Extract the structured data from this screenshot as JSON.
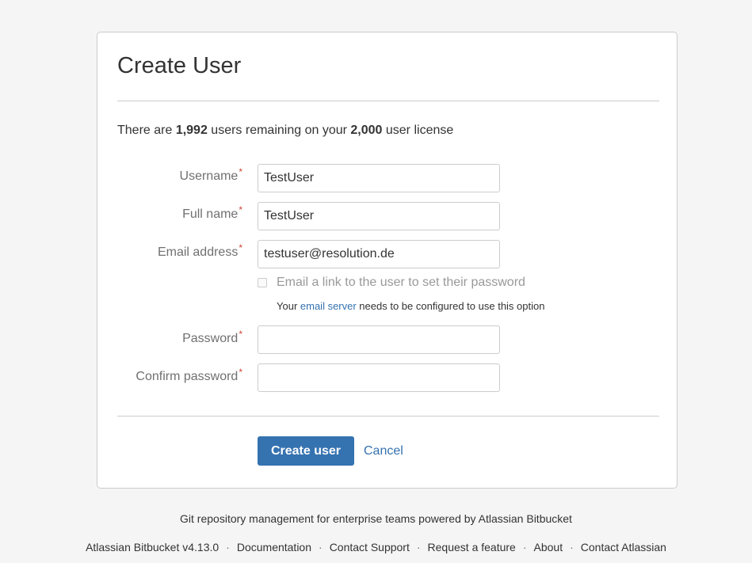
{
  "page": {
    "title": "Create User"
  },
  "license": {
    "prefix": "There are ",
    "remaining": "1,992",
    "middle": " users remaining on your ",
    "total": "2,000",
    "suffix": " user license"
  },
  "form": {
    "username": {
      "label": "Username",
      "value": "TestUser"
    },
    "full_name": {
      "label": "Full name",
      "value": "TestUser"
    },
    "email": {
      "label": "Email address",
      "value": "testuser@resolution.de"
    },
    "email_link_checkbox": {
      "label": "Email a link to the user to set their password",
      "checked": false
    },
    "email_hint": {
      "prefix": "Your ",
      "link": "email server",
      "suffix": " needs to be configured to use this option"
    },
    "password": {
      "label": "Password",
      "value": ""
    },
    "confirm_password": {
      "label": "Confirm password",
      "value": ""
    },
    "required_marker": "*"
  },
  "actions": {
    "create": "Create user",
    "cancel": "Cancel"
  },
  "footer": {
    "tagline": "Git repository management for enterprise teams powered by Atlassian Bitbucket",
    "separator": "·",
    "links": [
      "Atlassian Bitbucket v4.13.0",
      "Documentation",
      "Contact Support",
      "Request a feature",
      "About",
      "Contact Atlassian"
    ]
  },
  "colors": {
    "primary": "#3572b0",
    "required": "#d04437",
    "background": "#f5f5f5"
  }
}
